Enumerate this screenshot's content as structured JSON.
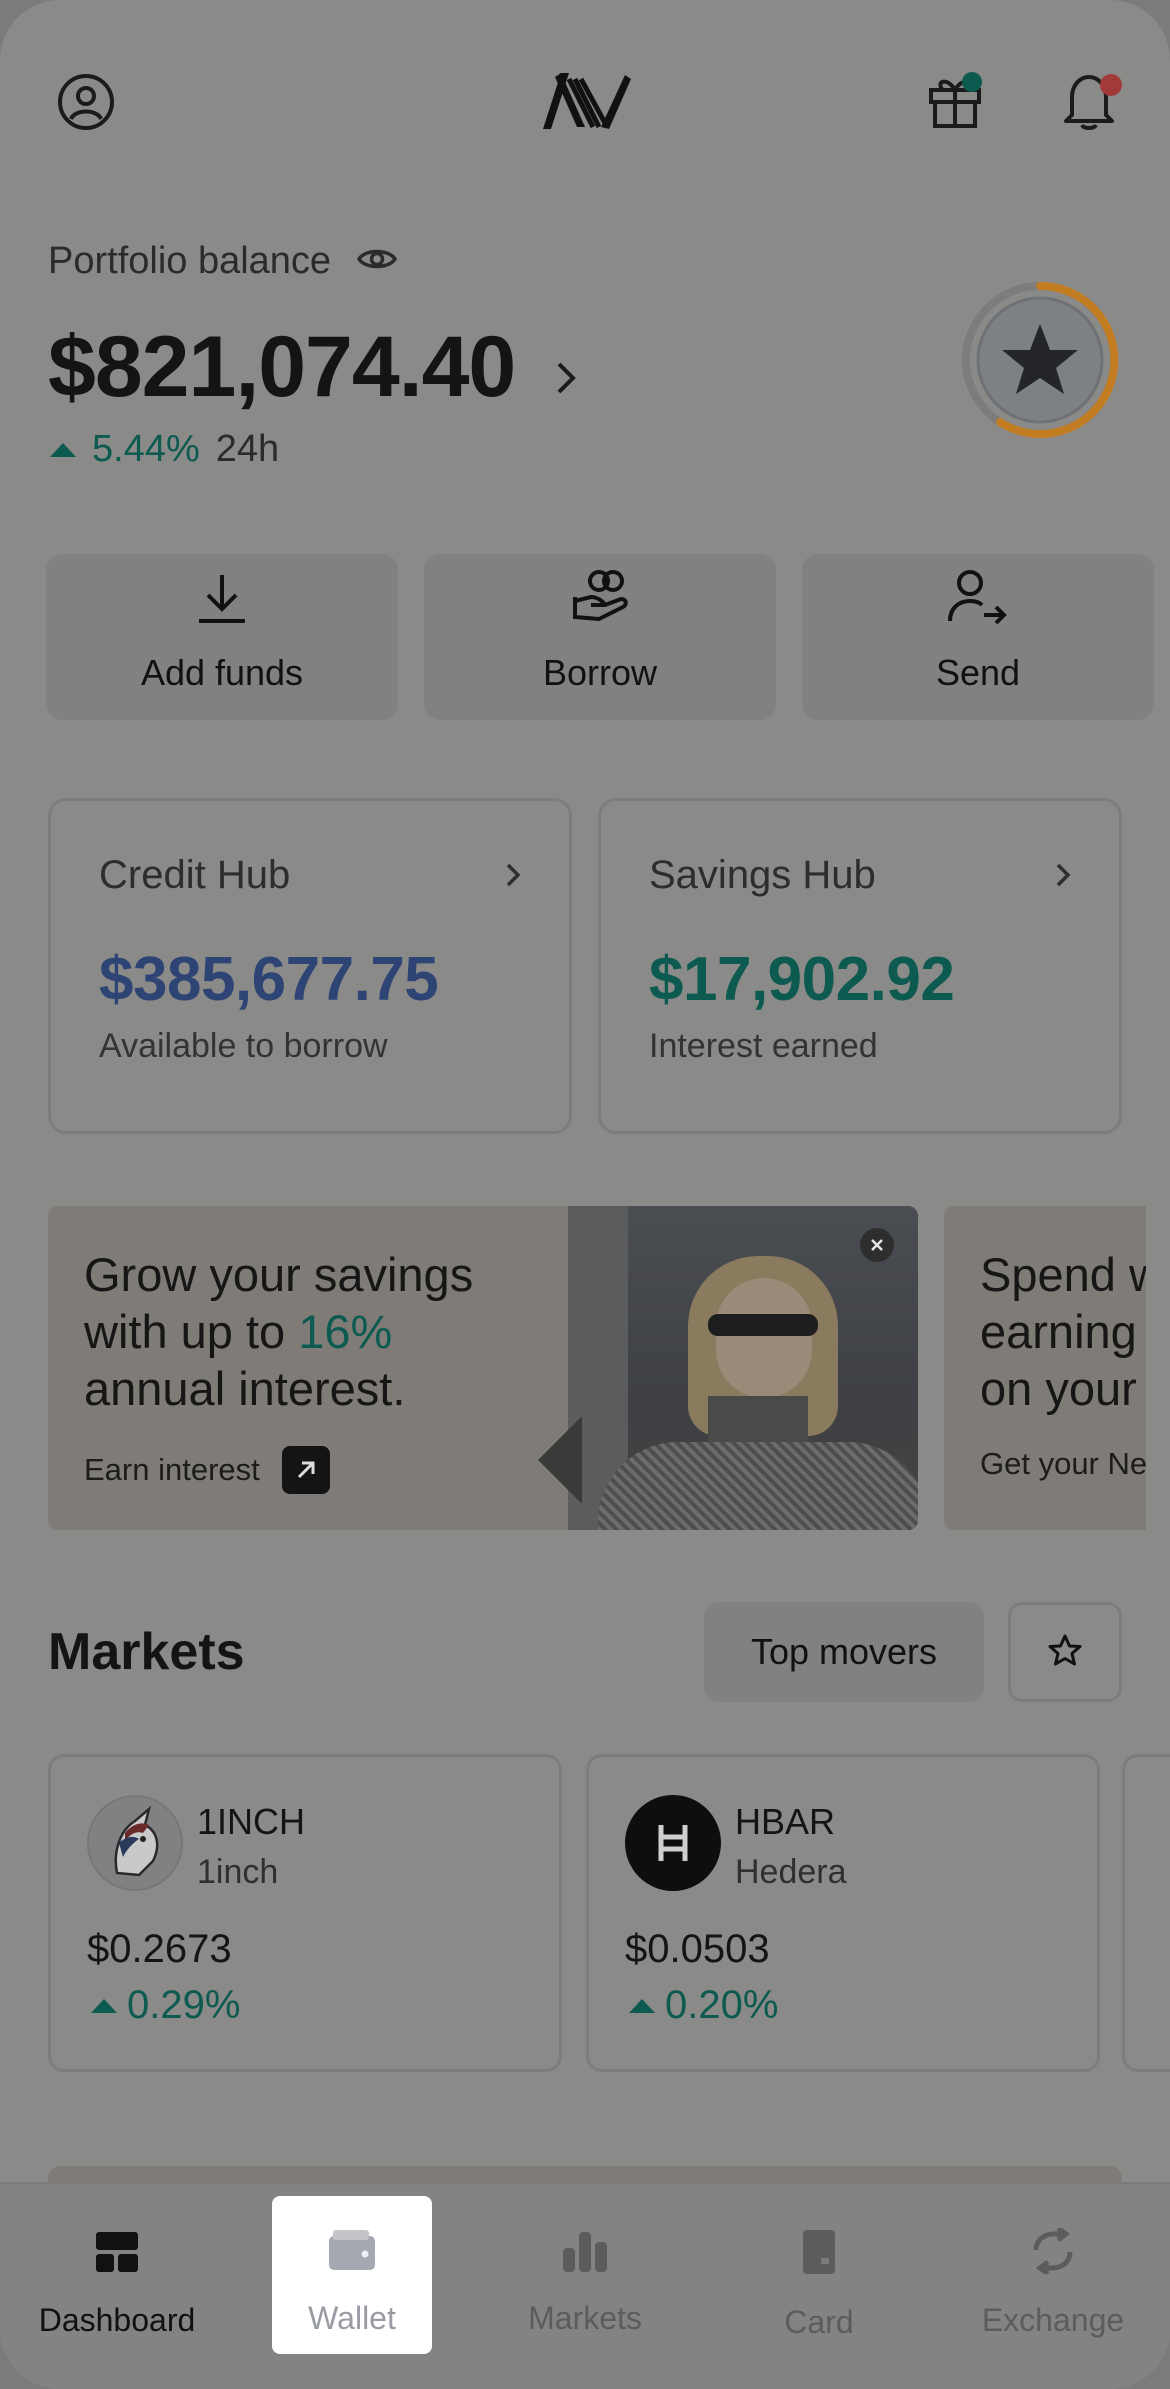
{
  "header": {
    "profile_icon": "user-circle-icon",
    "logo": "nexo-logo",
    "gift_icon": "gift-icon",
    "bell_icon": "bell-icon",
    "gift_dot_color": "#0d5a50",
    "bell_dot_color": "#a23a3a"
  },
  "portfolio": {
    "label": "Portfolio balance",
    "amount": "$821,074.40",
    "change": "5.44%",
    "period": "24h",
    "loyalty_icon": "star-icon",
    "ring_color": "#c27d22"
  },
  "actions": [
    {
      "label": "Add funds",
      "icon": "download-icon"
    },
    {
      "label": "Borrow",
      "icon": "hand-coins-icon"
    },
    {
      "label": "Send",
      "icon": "user-send-icon"
    }
  ],
  "hubs": {
    "credit": {
      "title": "Credit Hub",
      "value": "$385,677.75",
      "sub": "Available to borrow",
      "color": "#2e4475"
    },
    "savings": {
      "title": "Savings Hub",
      "value": "$17,902.92",
      "sub": "Interest earned",
      "color": "#0d5a50"
    }
  },
  "promos": [
    {
      "line1": "Grow your savings",
      "line2_pre": "with up to ",
      "line2_highlight": "16%",
      "line3": "annual interest.",
      "link": "Earn interest"
    },
    {
      "line1": "Spend w",
      "line2": "earning",
      "line3": "on your",
      "link": "Get your Ne"
    }
  ],
  "markets": {
    "title": "Markets",
    "filter_label": "Top movers",
    "favorites_icon": "star-outline-icon",
    "coins": [
      {
        "symbol": "1INCH",
        "name": "1inch",
        "price": "$0.2673",
        "change": "0.29%"
      },
      {
        "symbol": "HBAR",
        "name": "Hedera",
        "price": "$0.0503",
        "change": "0.20%"
      }
    ]
  },
  "nav": {
    "items": [
      {
        "label": "Dashboard",
        "icon": "dashboard-icon"
      },
      {
        "label": "Wallet",
        "icon": "wallet-icon"
      },
      {
        "label": "Markets",
        "icon": "bar-chart-icon"
      },
      {
        "label": "Card",
        "icon": "card-icon"
      },
      {
        "label": "Exchange",
        "icon": "exchange-icon"
      }
    ]
  }
}
